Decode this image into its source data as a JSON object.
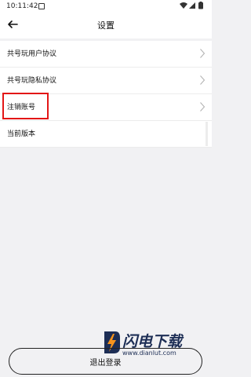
{
  "status_bar": {
    "time": "10:11:42"
  },
  "header": {
    "title": "设置",
    "back_icon": "arrow-left-icon"
  },
  "settings": {
    "items": [
      {
        "label": "共号玩用户协议",
        "icon": "chevron-right-icon"
      },
      {
        "label": "共号玩隐私协议",
        "icon": "chevron-right-icon"
      },
      {
        "label": "注销账号",
        "icon": "chevron-right-icon"
      },
      {
        "label": "当前版本",
        "value": ""
      }
    ]
  },
  "footer": {
    "logout_label": "退出登录"
  },
  "watermark": {
    "brand": "闪电下载",
    "url": "www.dianlut.com"
  },
  "colors": {
    "highlight": "#e31616",
    "background": "#f1f1f3",
    "watermark": "#1d2e55",
    "watermark_accent": "#f7941d"
  }
}
